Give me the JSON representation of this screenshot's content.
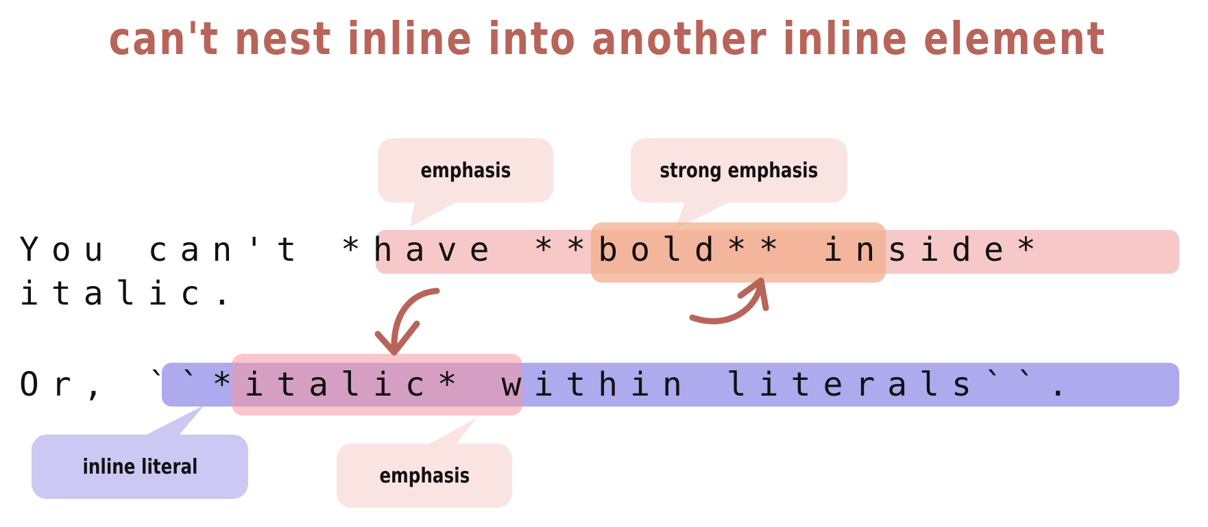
{
  "title": "can't nest inline into another inline element",
  "lines": {
    "line1_part1": "You can't ",
    "line1_part2": "*have ",
    "line1_part3": "**bold**",
    "line1_part4": " inside*",
    "line2": "italic.",
    "line3_part1": "Or, ",
    "line3_part2": "``",
    "line3_part3": "*italic*",
    "line3_part4": " within literals``",
    "line3_part5": "."
  },
  "callouts": {
    "emphasis_top": "emphasis",
    "strong_emphasis": "strong emphasis",
    "inline_literal": "inline literal",
    "emphasis_bottom": "emphasis"
  },
  "colors": {
    "title": "#b8645a",
    "arrow": "#b8645a",
    "emphasis_highlight": "#f7c8c8",
    "strong_highlight": "#f2af8c",
    "literal_highlight": "#aeaaee",
    "emphasis_bubble": "#fae4e2",
    "literal_bubble": "#cbc9f3"
  }
}
